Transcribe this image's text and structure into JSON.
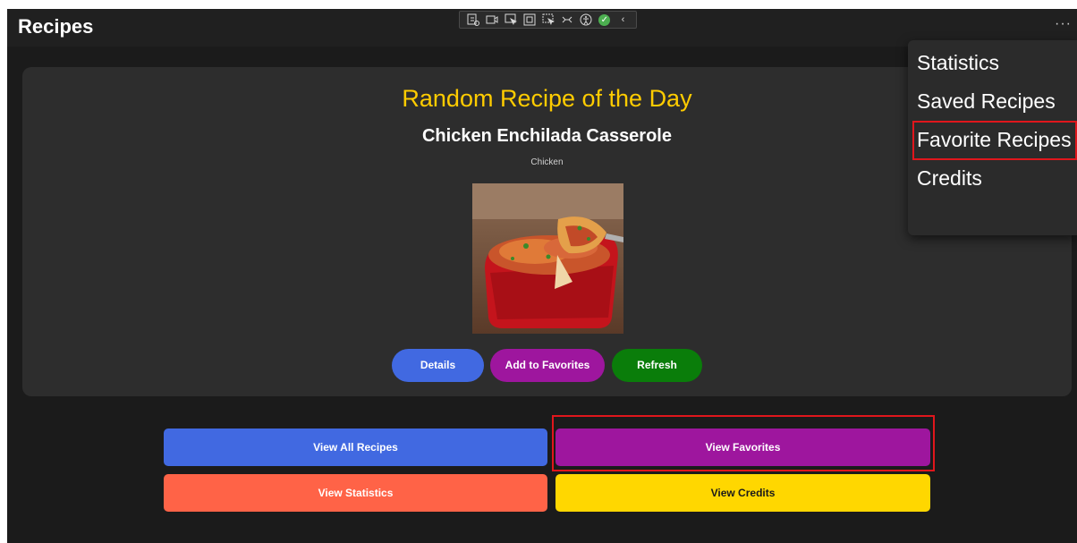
{
  "app": {
    "title": "Recipes",
    "more_label": "···"
  },
  "debug_toolbar": {
    "icons": [
      "live-visual-tree-icon",
      "record-icon",
      "select-element-icon",
      "display-layout-icon",
      "track-focus-icon",
      "binding-failures-icon",
      "accessibility-icon",
      "status-ok-icon",
      "collapse-icon"
    ]
  },
  "recipe_card": {
    "heading": "Random Recipe of the Day",
    "name": "Chicken Enchilada Casserole",
    "category": "Chicken",
    "image_alt": "Chicken enchilada casserole in a red baking dish",
    "buttons": {
      "details": "Details",
      "add_favorite": "Add to Favorites",
      "refresh": "Refresh"
    }
  },
  "nav_buttons": {
    "view_all": "View All Recipes",
    "view_favorites": "View Favorites",
    "view_statistics": "View Statistics",
    "view_credits": "View Credits"
  },
  "flyout_menu": {
    "items": [
      "Statistics",
      "Saved Recipes",
      "Favorite Recipes",
      "Credits"
    ]
  },
  "colors": {
    "heading": "#ffcc00",
    "blue": "#4169e1",
    "purple": "#9e169e",
    "green": "#0a7d0a",
    "tomato": "#ff6347",
    "gold": "#ffd700",
    "highlight": "#e0161c"
  }
}
